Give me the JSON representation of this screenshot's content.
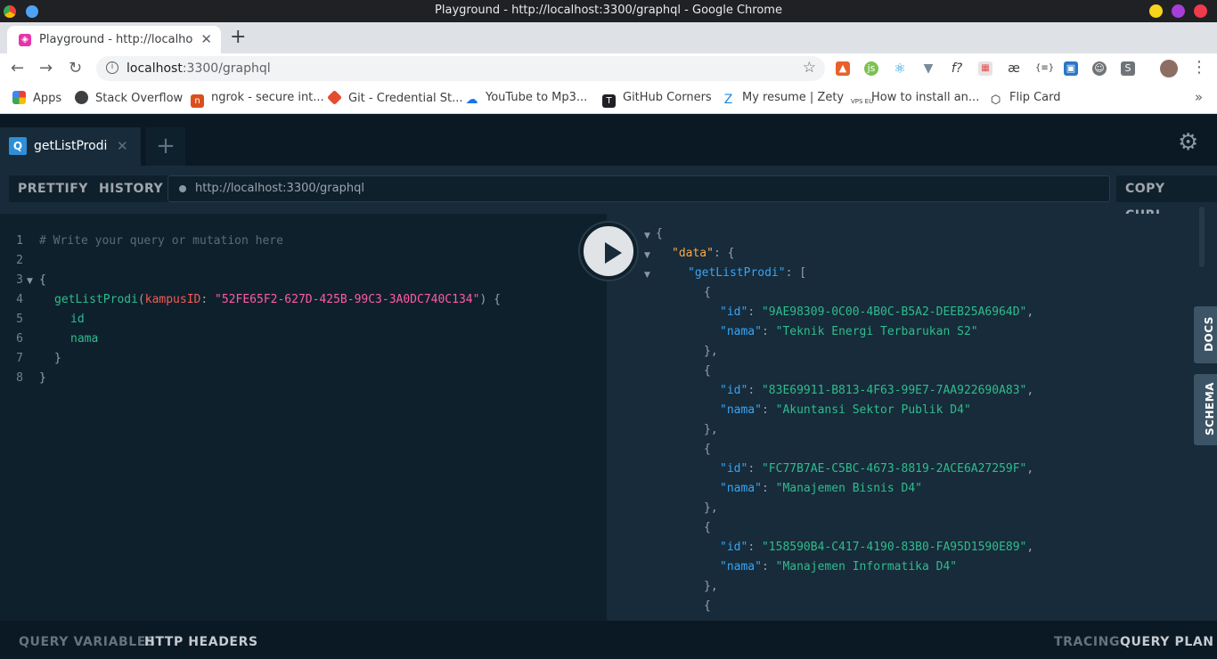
{
  "window": {
    "title": "Playground - http://localhost:3300/graphql - Google Chrome",
    "tab_title": "Playground - http://localhost:3300/graphql",
    "url_host": "localhost",
    "url_rest": ":3300/graphql"
  },
  "bookmarks": [
    {
      "label": "Apps"
    },
    {
      "label": "Stack Overflow"
    },
    {
      "label": "ngrok - secure int..."
    },
    {
      "label": "Git - Credential St..."
    },
    {
      "label": "YouTube to Mp3..."
    },
    {
      "label": "GitHub Corners"
    },
    {
      "label": "My resume | Zety"
    },
    {
      "label": "How to install an..."
    },
    {
      "label": "Flip Card"
    }
  ],
  "playground": {
    "tab_name": "getListProdi",
    "tab_badge": "Q",
    "prettify": "PRETTIFY",
    "history": "HISTORY",
    "endpoint": "http://localhost:3300/graphql",
    "copy_curl": "COPY CURL",
    "docs": "DOCS",
    "schema": "SCHEMA",
    "query_variables": "QUERY VARIABLES",
    "http_headers": "HTTP HEADERS",
    "tracing": "TRACING",
    "query_plan": "QUERY PLAN",
    "query": {
      "line_numbers": [
        "1",
        "2",
        "3",
        "4",
        "5",
        "6",
        "7",
        "8"
      ],
      "comment": "# Write your query or mutation here",
      "open_brace": "{",
      "field": "getListProdi",
      "arg_name": "kampusID",
      "arg_value": "\"52FE65F2-627D-425B-99C3-3A0DC740C134\"",
      "sub_fields": [
        "id",
        "nama"
      ],
      "close_inner": "}",
      "close_outer": "}"
    },
    "result": {
      "root_key": "\"data\"",
      "list_key": "\"getListProdi\"",
      "items": [
        {
          "id": "\"9AE98309-0C00-4B0C-B5A2-DEEB25A6964D\"",
          "nama": "\"Teknik Energi Terbarukan S2\""
        },
        {
          "id": "\"83E69911-B813-4F63-99E7-7AA922690A83\"",
          "nama": "\"Akuntansi Sektor Publik D4\""
        },
        {
          "id": "\"FC77B7AE-C5BC-4673-8819-2ACE6A27259F\"",
          "nama": "\"Manajemen Bisnis D4\""
        },
        {
          "id": "\"158590B4-C417-4190-83B0-FA95D1590E89\"",
          "nama": "\"Manajemen Informatika D4\""
        }
      ]
    }
  }
}
